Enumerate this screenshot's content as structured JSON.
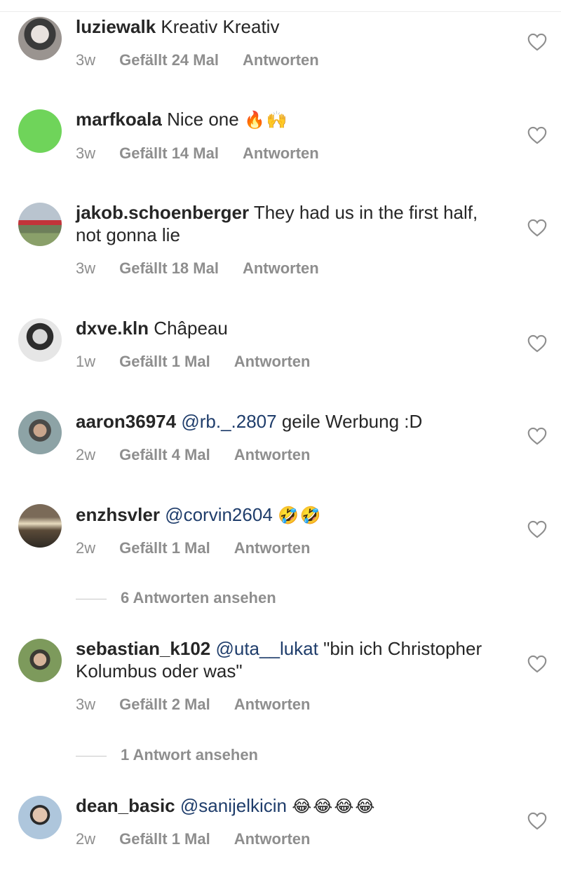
{
  "comments": [
    {
      "username": "luziewalk",
      "text": "Kreativ Kreativ",
      "time": "3w",
      "likes": "Gefällt 24 Mal",
      "reply": "Antworten"
    },
    {
      "username": "marfkoala",
      "text": "Nice one",
      "emoji": "🔥🙌",
      "time": "3w",
      "likes": "Gefällt 14 Mal",
      "reply": "Antworten",
      "avatar_color": "#6fd45a"
    },
    {
      "username": "jakob.schoenberger",
      "text": "They had us in the first half, not gonna lie",
      "time": "3w",
      "likes": "Gefällt 18 Mal",
      "reply": "Antworten"
    },
    {
      "username": "dxve.kln",
      "text": "Châpeau",
      "time": "1w",
      "likes": "Gefällt 1 Mal",
      "reply": "Antworten"
    },
    {
      "username": "aaron36974",
      "mention": "@rb._.2807",
      "text": "geile Werbung :D",
      "time": "2w",
      "likes": "Gefällt 4 Mal",
      "reply": "Antworten"
    },
    {
      "username": "enzhsvler",
      "mention": "@corvin2604",
      "emoji": "🤣🤣",
      "time": "2w",
      "likes": "Gefällt 1 Mal",
      "reply": "Antworten",
      "view_replies": "6 Antworten ansehen"
    },
    {
      "username": "sebastian_k102",
      "mention": "@uta__lukat",
      "text": "\"bin ich Christopher Kolumbus oder was\"",
      "time": "3w",
      "likes": "Gefällt 2 Mal",
      "reply": "Antworten",
      "view_replies": "1 Antwort ansehen"
    },
    {
      "username": "dean_basic",
      "mention": "@sanijelkicin",
      "emoji": "😂😂😂😂",
      "time": "2w",
      "likes": "Gefällt 1 Mal",
      "reply": "Antworten"
    }
  ],
  "icons": {
    "like": "heart-outline-icon"
  },
  "colors": {
    "text": "#262626",
    "meta": "#8e8e8e",
    "mention": "#1f3d6b"
  }
}
